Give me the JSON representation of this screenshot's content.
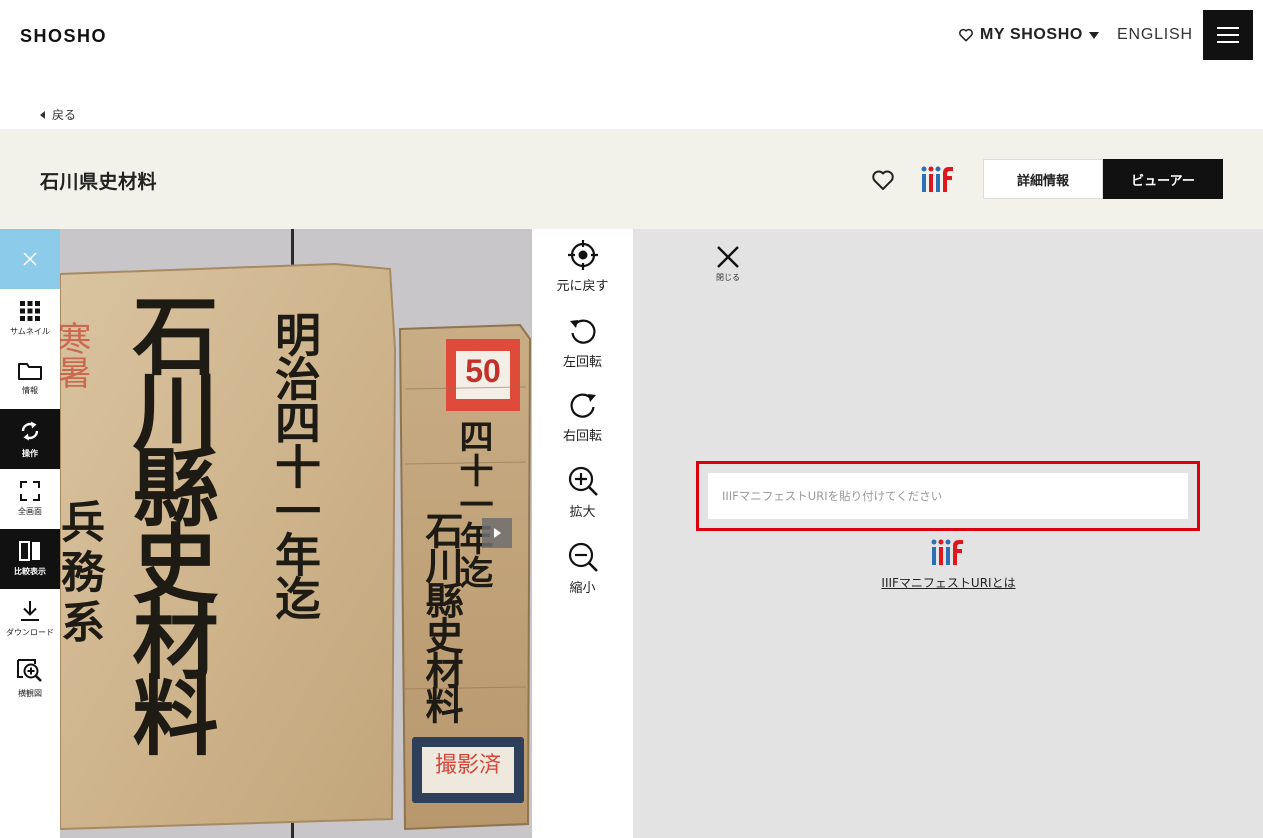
{
  "header": {
    "logo": "SHOSHO",
    "my_shosho": "MY SHOSHO",
    "language": "ENGLISH"
  },
  "nav": {
    "back_label": "戻る"
  },
  "document": {
    "title": "石川県史材料",
    "detail_button": "詳細情報",
    "viewer_button": "ビューアー"
  },
  "sidebar": {
    "items": [
      {
        "label": "サムネイル",
        "icon": "grid-icon"
      },
      {
        "label": "情報",
        "icon": "folder-icon"
      },
      {
        "label": "操作",
        "icon": "rotate-arrows-icon",
        "active": true
      },
      {
        "label": "全画面",
        "icon": "fullscreen-icon"
      },
      {
        "label": "比較表示",
        "icon": "compare-icon",
        "active": true
      },
      {
        "label": "ダウンロード",
        "icon": "download-icon"
      },
      {
        "label": "横観図",
        "icon": "magnifier-overview-icon"
      }
    ]
  },
  "operations": {
    "reset": "元に戻す",
    "rotate_left": "左回転",
    "rotate_right": "右回転",
    "zoom_in": "拡大",
    "zoom_out": "縮小"
  },
  "compare_panel": {
    "close_label": "閉じる",
    "uri_placeholder": "IIIFマニフェストURIを貼り付けてください",
    "uri_value": "",
    "help_link": "IIIFマニフェストURIとは"
  },
  "image": {
    "cover_left_title": "石川縣史材料",
    "cover_left_date": "明治四十一年迄",
    "cover_left_side": "寒暑",
    "cover_left_lower": "兵務系",
    "cover_right_title": "石川縣史材料",
    "cover_right_date": "四十一年迄",
    "cover_right_number": "50",
    "cover_right_stamp": "撮影済"
  },
  "colors": {
    "accent_blue": "#8ccbea",
    "highlight_red": "#d90010",
    "iiif_red": "#e0161f",
    "iiif_blue": "#2b6fb4",
    "title_band": "#f3f2ea"
  }
}
